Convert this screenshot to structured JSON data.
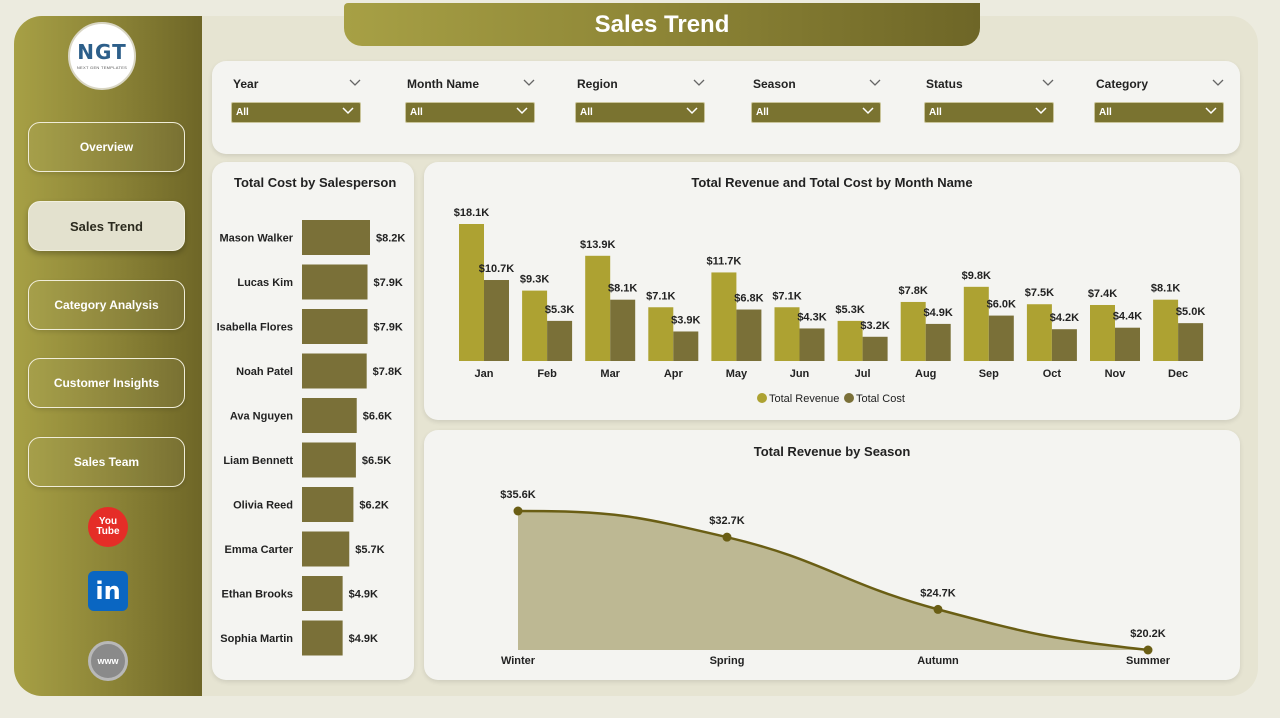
{
  "header": {
    "title": "Sales Trend"
  },
  "logo": {
    "mark": "NGT",
    "subtitle": "NEXT GEN TEMPLATES"
  },
  "nav": {
    "items": [
      {
        "label": "Overview",
        "active": false
      },
      {
        "label": "Sales Trend",
        "active": true
      },
      {
        "label": "Category Analysis",
        "active": false
      },
      {
        "label": "Customer Insights",
        "active": false
      },
      {
        "label": "Sales Team",
        "active": false
      }
    ]
  },
  "social": {
    "youtube_top": "You",
    "youtube_bottom": "Tube",
    "linkedin": "in",
    "web": "www"
  },
  "filters": [
    {
      "label": "Year",
      "value": "All"
    },
    {
      "label": "Month Name",
      "value": "All"
    },
    {
      "label": "Region",
      "value": "All"
    },
    {
      "label": "Season",
      "value": "All"
    },
    {
      "label": "Status",
      "value": "All"
    },
    {
      "label": "Category",
      "value": "All"
    }
  ],
  "colors": {
    "accent_dark": "#6e6627",
    "accent_light": "#a7a045",
    "revenue": "#ada232",
    "cost": "#7a7038",
    "area_fill": "#bdb893"
  },
  "chart_data": [
    {
      "type": "bar",
      "orientation": "horizontal",
      "title": "Total Cost by Salesperson",
      "categories": [
        "Mason Walker",
        "Lucas Kim",
        "Isabella Flores",
        "Noah Patel",
        "Ava Nguyen",
        "Liam Bennett",
        "Olivia Reed",
        "Emma Carter",
        "Ethan Brooks",
        "Sophia Martin"
      ],
      "values": [
        8.2,
        7.9,
        7.9,
        7.8,
        6.6,
        6.5,
        6.2,
        5.7,
        4.9,
        4.9
      ],
      "labels": [
        "$8.2K",
        "$7.9K",
        "$7.9K",
        "$7.8K",
        "$6.6K",
        "$6.5K",
        "$6.2K",
        "$5.7K",
        "$4.9K",
        "$4.9K"
      ],
      "unit": "$K"
    },
    {
      "type": "bar",
      "title": "Total Revenue and Total Cost by Month Name",
      "categories": [
        "Jan",
        "Feb",
        "Mar",
        "Apr",
        "May",
        "Jun",
        "Jul",
        "Aug",
        "Sep",
        "Oct",
        "Nov",
        "Dec"
      ],
      "series": [
        {
          "name": "Total Revenue",
          "values": [
            18.1,
            9.3,
            13.9,
            7.1,
            11.7,
            7.1,
            5.3,
            7.8,
            9.8,
            7.5,
            7.4,
            8.1
          ],
          "labels": [
            "$18.1K",
            "$9.3K",
            "$13.9K",
            "$7.1K",
            "$11.7K",
            "$7.1K",
            "$5.3K",
            "$7.8K",
            "$9.8K",
            "$7.5K",
            "$7.4K",
            "$8.1K"
          ]
        },
        {
          "name": "Total Cost",
          "values": [
            10.7,
            5.3,
            8.1,
            3.9,
            6.8,
            4.3,
            3.2,
            4.9,
            6.0,
            4.2,
            4.4,
            5.0
          ],
          "labels": [
            "$10.7K",
            "$5.3K",
            "$8.1K",
            "$3.9K",
            "$6.8K",
            "$4.3K",
            "$3.2K",
            "$4.9K",
            "$6.0K",
            "$4.2K",
            "$4.4K",
            "$5.0K"
          ]
        }
      ],
      "legend": "bottom-center",
      "unit": "$K"
    },
    {
      "type": "area",
      "title": "Total Revenue by Season",
      "categories": [
        "Winter",
        "Spring",
        "Autumn",
        "Summer"
      ],
      "values": [
        35.6,
        32.7,
        24.7,
        20.2
      ],
      "labels": [
        "$35.6K",
        "$32.7K",
        "$24.7K",
        "$20.2K"
      ],
      "unit": "$K"
    }
  ]
}
